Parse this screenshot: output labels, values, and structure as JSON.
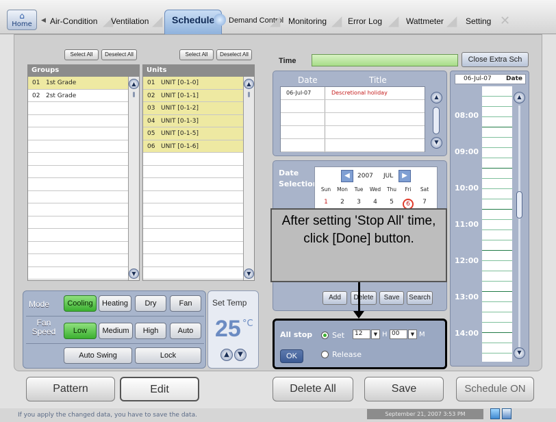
{
  "app": {
    "home_label": "Home",
    "tabs": [
      "Air-Condition",
      "Ventilation",
      "Schedule",
      "Demand Control",
      "Monitoring",
      "Error Log",
      "Wattmeter",
      "Setting"
    ],
    "active_tab": "Schedule"
  },
  "groups": {
    "select_all": "Select All",
    "deselect_all": "Deselect All",
    "header": "Groups",
    "rows": [
      {
        "num": "01",
        "name": "1st Grade",
        "selected": true
      },
      {
        "num": "02",
        "name": "2st Grade",
        "selected": false
      }
    ]
  },
  "units": {
    "select_all": "Select All",
    "deselect_all": "Deselect All",
    "header": "Units",
    "rows": [
      {
        "num": "01",
        "name": "UNIT [0-1-0]"
      },
      {
        "num": "02",
        "name": "UNIT [0-1-1]"
      },
      {
        "num": "03",
        "name": "UNIT [0-1-2]"
      },
      {
        "num": "04",
        "name": "UNIT [0-1-3]"
      },
      {
        "num": "05",
        "name": "UNIT [0-1-5]"
      },
      {
        "num": "06",
        "name": "UNIT [0-1-6]"
      }
    ]
  },
  "mode": {
    "mode_label": "Mode",
    "modes": [
      "Cooling",
      "Heating",
      "Dry",
      "Fan"
    ],
    "active_mode": "Cooling",
    "fan_label": "Fan Speed",
    "speeds": [
      "Low",
      "Medium",
      "High",
      "Auto"
    ],
    "active_speed": "Low",
    "auto_swing": "Auto Swing",
    "lock": "Lock"
  },
  "set_temp": {
    "label": "Set Temp",
    "value": "25",
    "unit": "°C"
  },
  "schedule": {
    "time_label": "Time",
    "close_extra": "Close Extra Sch",
    "date_header": "Date",
    "title_header": "Title",
    "events": [
      {
        "date": "06-Jul-07",
        "title": "Descretional holiday"
      }
    ],
    "date_selection": "Date Selection",
    "year": "2007",
    "month": "JUL",
    "weekdays": [
      "Sun",
      "Mon",
      "Tue",
      "Wed",
      "Thu",
      "Fri",
      "Sat"
    ],
    "visible_days": [
      "1",
      "2",
      "3",
      "4",
      "5",
      "6",
      "7"
    ],
    "selected_day": "6",
    "add": "Add",
    "delete": "Delete",
    "save": "Save",
    "search": "Search",
    "timeline_date": "06-Jul-07",
    "timeline_date_label": "Date",
    "hours": [
      "08:00",
      "09:00",
      "10:00",
      "11:00",
      "12:00",
      "13:00",
      "14:00"
    ]
  },
  "callout": {
    "text": "After setting 'Stop All' time, click [Done] button."
  },
  "all_stop": {
    "label": "All stop",
    "ok": "OK",
    "set": "Set",
    "release": "Release",
    "hour": "12",
    "hour_unit": "H",
    "minute": "00",
    "minute_unit": "M"
  },
  "bottom": {
    "pattern": "Pattern",
    "edit": "Edit",
    "delete_all": "Delete All",
    "save": "Save",
    "schedule_on": "Schedule ON"
  },
  "status": {
    "message": "If you apply the changed data,  you have to save the data.",
    "datetime": "September 21, 2007 3:53 PM"
  },
  "colors": {
    "accent_blue": "#a9b4ca",
    "selection_yellow": "#eee9a2",
    "active_green": "#3bb030",
    "timeline_green": "#2ea35c"
  }
}
